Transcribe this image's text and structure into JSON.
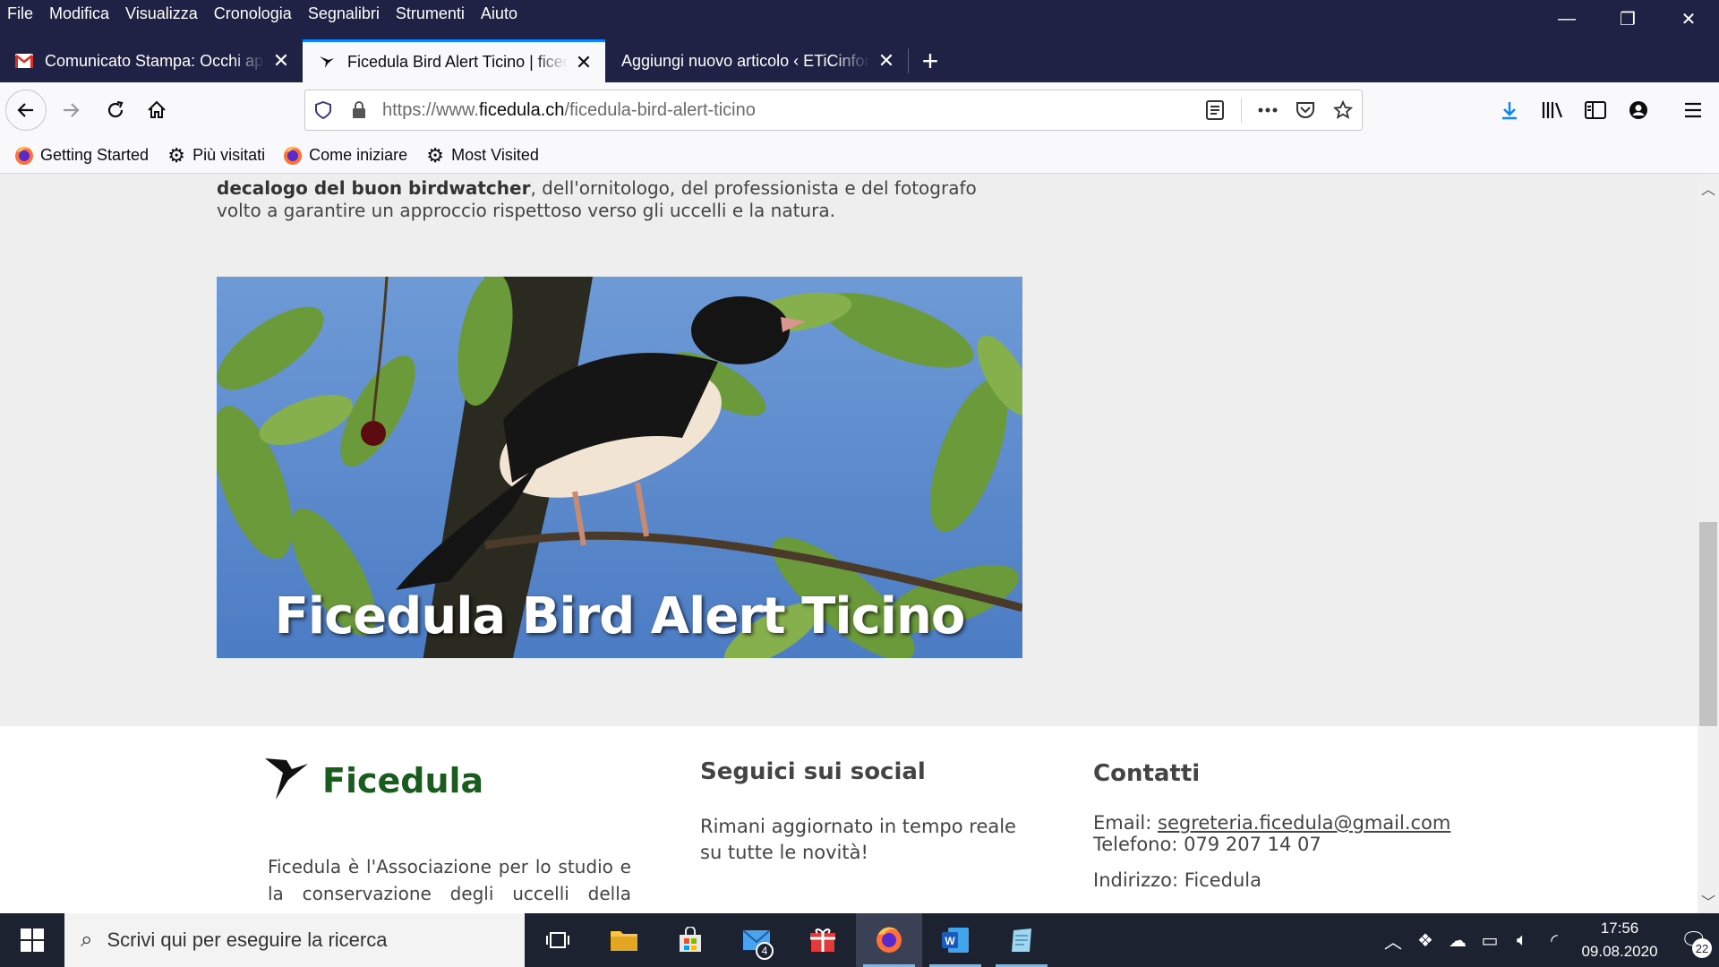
{
  "menu": [
    "File",
    "Modifica",
    "Visualizza",
    "Cronologia",
    "Segnalibri",
    "Strumenti",
    "Aiuto"
  ],
  "window_controls": {
    "minimize": "—",
    "restore": "❐",
    "close": "✕"
  },
  "tabs": [
    {
      "title": "Comunicato Stampa: Occhi aperti",
      "icon": "gmail-icon",
      "close": "✕",
      "active": false
    },
    {
      "title": "Ficedula Bird Alert Ticino | ficedula",
      "icon": "bird-logo-icon",
      "close": "✕",
      "active": true
    },
    {
      "title": "Aggiungi nuovo articolo ‹ ETiCinforma",
      "icon": "",
      "close": "✕",
      "active": false
    }
  ],
  "new_tab": "+",
  "url": {
    "prefix": "https://www.",
    "domain": "ficedula.ch",
    "path": "/ficedula-bird-alert-ticino"
  },
  "bookmarks": [
    {
      "label": "Getting Started",
      "icon": "firefox-icon"
    },
    {
      "label": "Più visitati",
      "icon": "gear-icon"
    },
    {
      "label": "Come iniziare",
      "icon": "firefox-icon"
    },
    {
      "label": "Most Visited",
      "icon": "gear-icon"
    }
  ],
  "article": {
    "bold": "decalogo del buon birdwatcher",
    "line1_rest": ", dell'ornitologo, del professionista e del fotografo",
    "line2": "volto a garantire un approccio rispettoso verso gli uccelli e la natura."
  },
  "hero": {
    "title": "Ficedula Bird Alert Ticino"
  },
  "footer": {
    "brand": "Ficedula",
    "brand_desc": "Ficedula è l'Associazione per lo studio e la conservazione degli uccelli della",
    "social_heading": "Seguici sui social",
    "social_text_1": "Rimani aggiornato in tempo reale",
    "social_text_2": "su tutte le novità!",
    "contacts_heading": "Contatti",
    "email_label": "Email: ",
    "email": "segreteria.ficedula@gmail.com",
    "phone": "Telefono: 079 207 14 07",
    "address": "Indirizzo: Ficedula"
  },
  "taskbar": {
    "search_placeholder": "Scrivi qui per eseguire la ricerca",
    "mail_badge": "4",
    "time": "17:56",
    "date": "09.08.2020",
    "notifications": "22"
  },
  "colors": {
    "titlebar": "#1f2145",
    "accent": "#0a84ff",
    "brand_green": "#1a5c1e",
    "taskbar": "#1c2230"
  }
}
